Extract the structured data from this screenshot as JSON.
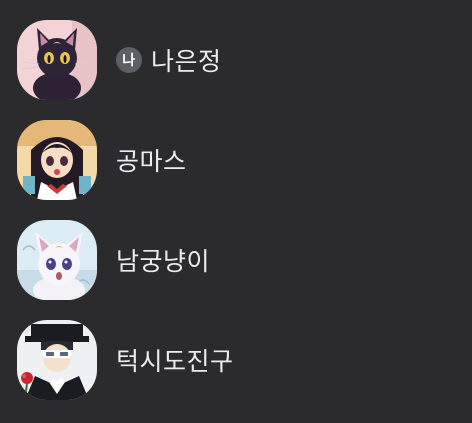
{
  "friends": [
    {
      "avatar_icon": "luna-cat-avatar-icon",
      "me_badge": "나",
      "name": "나은정"
    },
    {
      "avatar_icon": "rei-avatar-icon",
      "name": "공마스"
    },
    {
      "avatar_icon": "artemis-cat-avatar-icon",
      "name": "남궁냥이"
    },
    {
      "avatar_icon": "tuxedo-mask-avatar-icon",
      "name": "턱시도진구"
    }
  ],
  "colors": {
    "background": "#2b2b2d",
    "text": "#ececec",
    "badge": "#5c6066"
  }
}
